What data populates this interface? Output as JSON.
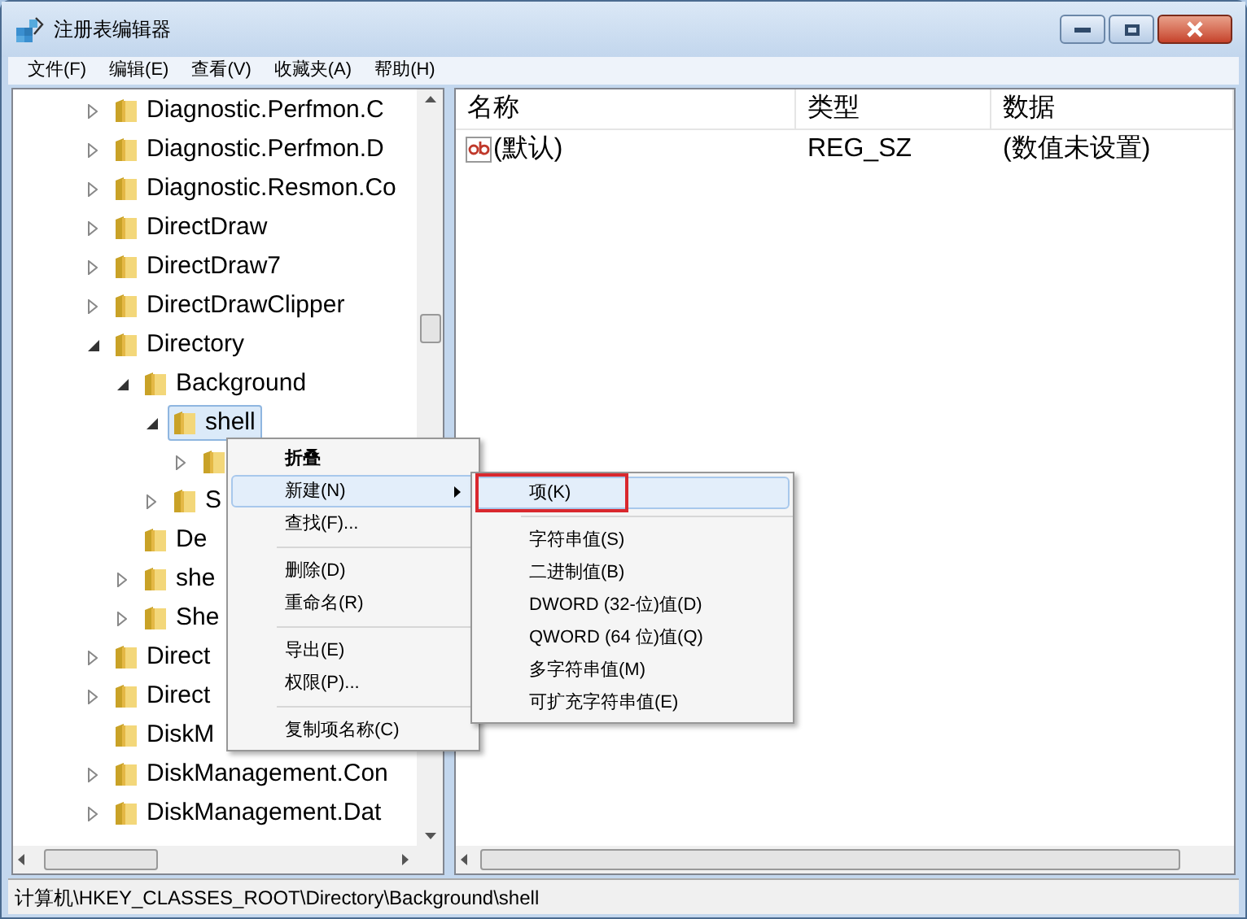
{
  "window": {
    "title": "注册表编辑器"
  },
  "menu_bar": [
    "文件(F)",
    "编辑(E)",
    "查看(V)",
    "收藏夹(A)",
    "帮助(H)"
  ],
  "tree": [
    {
      "label": "Diagnostic.Perfmon.C",
      "has_children": true,
      "expanded": false,
      "selected": false
    },
    {
      "label": "Diagnostic.Perfmon.D",
      "has_children": true,
      "expanded": false,
      "selected": false
    },
    {
      "label": "Diagnostic.Resmon.Co",
      "has_children": true,
      "expanded": false,
      "selected": false
    },
    {
      "label": "DirectDraw",
      "has_children": true,
      "expanded": false,
      "selected": false
    },
    {
      "label": "DirectDraw7",
      "has_children": true,
      "expanded": false,
      "selected": false
    },
    {
      "label": "DirectDrawClipper",
      "has_children": true,
      "expanded": false,
      "selected": false
    },
    {
      "label": "Directory",
      "has_children": true,
      "expanded": true,
      "selected": false,
      "children": [
        {
          "label": "Background",
          "has_children": true,
          "expanded": true,
          "selected": false,
          "children": [
            {
              "label": "shell",
              "has_children": true,
              "expanded": true,
              "selected": true,
              "children": [
                {
                  "has_children": true,
                  "expanded": false,
                  "selected": false
                }
              ]
            },
            {
              "label": "S",
              "has_children": true,
              "expanded": false,
              "selected": false
            }
          ]
        },
        {
          "label": "De",
          "has_children": false,
          "expanded": false,
          "selected": false
        },
        {
          "label": "she",
          "has_children": true,
          "expanded": false,
          "selected": false
        },
        {
          "label": "She",
          "has_children": true,
          "expanded": false,
          "selected": false
        }
      ]
    },
    {
      "label": "Direct",
      "has_children": true,
      "expanded": false,
      "selected": false
    },
    {
      "label": "Direct",
      "has_children": true,
      "expanded": false,
      "selected": false
    },
    {
      "label": "DiskM",
      "has_children": false,
      "expanded": false,
      "selected": false
    },
    {
      "label": "DiskManagement.Con",
      "has_children": true,
      "expanded": false,
      "selected": false
    },
    {
      "label": "DiskManagement.Dat",
      "has_children": true,
      "expanded": false,
      "selected": false
    }
  ],
  "values_table": {
    "columns": [
      "名称",
      "类型",
      "数据"
    ],
    "rows": [
      {
        "name": "(默认)",
        "type": "REG_SZ",
        "data": "(数值未设置)"
      }
    ]
  },
  "context_menu": [
    {
      "kind": "item",
      "label": "折叠",
      "bold": true,
      "selected": false
    },
    {
      "kind": "item",
      "label": "新建(N)",
      "submenu": true,
      "selected": true
    },
    {
      "kind": "item",
      "label": "查找(F)...",
      "selected": false
    },
    {
      "kind": "separator"
    },
    {
      "kind": "item",
      "label": "删除(D)",
      "selected": false
    },
    {
      "kind": "item",
      "label": "重命名(R)",
      "selected": false
    },
    {
      "kind": "separator"
    },
    {
      "kind": "item",
      "label": "导出(E)",
      "selected": false
    },
    {
      "kind": "item",
      "label": "权限(P)...",
      "selected": false
    },
    {
      "kind": "separator"
    },
    {
      "kind": "item",
      "label": "复制项名称(C)",
      "selected": false
    }
  ],
  "submenu": [
    {
      "kind": "item",
      "label": "项(K)",
      "selected": true,
      "outlined": true
    },
    {
      "kind": "separator"
    },
    {
      "kind": "item",
      "label": "字符串值(S)",
      "selected": false,
      "outlined": false
    },
    {
      "kind": "item",
      "label": "二进制值(B)",
      "selected": false,
      "outlined": false
    },
    {
      "kind": "item",
      "label": "DWORD (32-位)值(D)",
      "selected": false,
      "outlined": false
    },
    {
      "kind": "item",
      "label": "QWORD (64 位)值(Q)",
      "selected": false,
      "outlined": false
    },
    {
      "kind": "item",
      "label": "多字符串值(M)",
      "selected": false,
      "outlined": false
    },
    {
      "kind": "item",
      "label": "可扩充字符串值(E)",
      "selected": false,
      "outlined": false
    }
  ],
  "status_bar": "计算机\\HKEY_CLASSES_ROOT\\Directory\\Background\\shell"
}
